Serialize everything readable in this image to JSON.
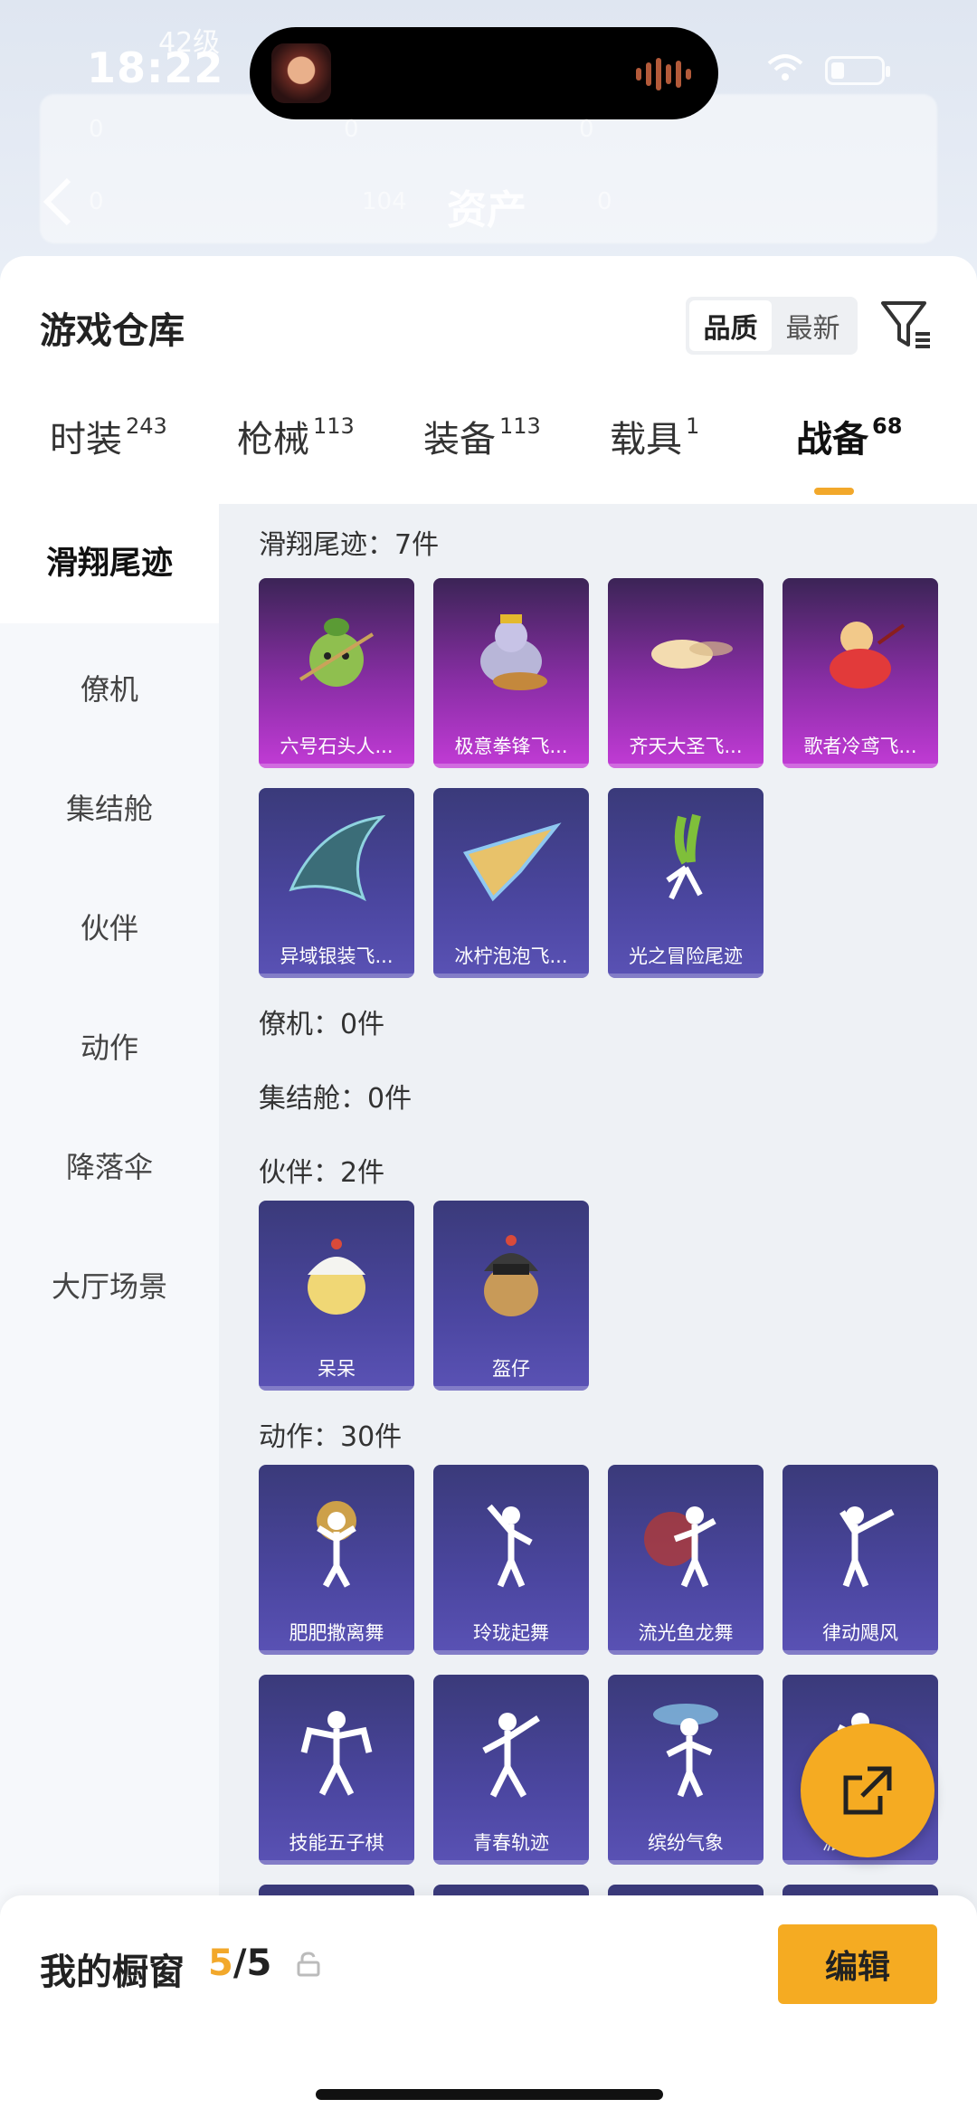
{
  "status": {
    "time": "18:22",
    "level": "42级"
  },
  "header": {
    "title": "资产",
    "faint_items": [
      "0",
      "0",
      "0",
      "0",
      "104",
      "0"
    ]
  },
  "warehouse": {
    "title": "游戏仓库",
    "sort_options": [
      "品质",
      "最新"
    ],
    "sort_selected": "品质"
  },
  "tabs": [
    {
      "label": "时装",
      "count": "243"
    },
    {
      "label": "枪械",
      "count": "113"
    },
    {
      "label": "装备",
      "count": "113"
    },
    {
      "label": "载具",
      "count": "1"
    },
    {
      "label": "战备",
      "count": "68"
    }
  ],
  "active_tab": "战备",
  "side_nav": [
    "滑翔尾迹",
    "僚机",
    "集结舱",
    "伙伴",
    "动作",
    "降落伞",
    "大厅场景"
  ],
  "sections": {
    "trails": {
      "title": "滑翔尾迹：7件",
      "items": [
        "六号石头人...",
        "极意拳锋飞...",
        "齐天大圣飞...",
        "歌者冷鸢飞...",
        "异域银装飞...",
        "冰柠泡泡飞...",
        "光之冒险尾迹"
      ]
    },
    "wingman": {
      "title": "僚机：0件"
    },
    "capsule": {
      "title": "集结舱：0件"
    },
    "partner": {
      "title": "伙伴：2件",
      "items": [
        "呆呆",
        "盔仔"
      ]
    },
    "emote": {
      "title": "动作：30件",
      "items": [
        "肥肥撒离舞",
        "玲珑起舞",
        "流光鱼龙舞",
        "律动飓风",
        "技能五子棋",
        "青春轨迹",
        "缤纷气象",
        "派对之星"
      ]
    }
  },
  "showcase": {
    "label": "我的橱窗",
    "current": "5",
    "total": "/5",
    "edit_label": "编辑"
  },
  "colors": {
    "accent": "#f5ab22",
    "rare_card": "#8a2ea6",
    "epic_card": "#4b46a0"
  }
}
